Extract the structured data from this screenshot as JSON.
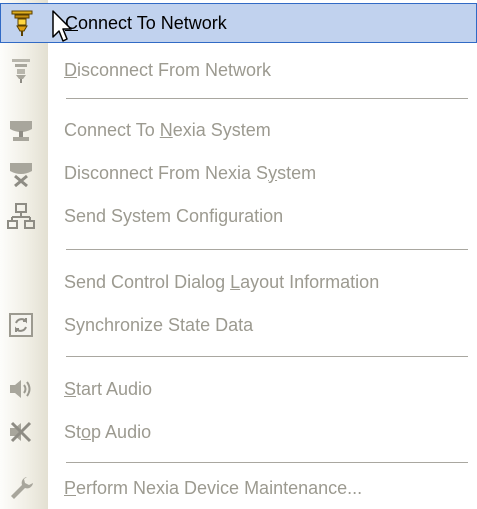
{
  "menu": {
    "items": [
      {
        "pre": "",
        "ul": "C",
        "post": "onnect To Network",
        "icon": "network-plug-icon",
        "state": "highlighted"
      },
      {
        "pre": "",
        "ul": "D",
        "post": "isconnect From Network",
        "icon": "network-unplug-icon",
        "state": "disabled"
      },
      {
        "pre": "Connect To ",
        "ul": "N",
        "post": "exia System",
        "icon": "system-connect-icon",
        "state": "disabled"
      },
      {
        "pre": "Disconnect From Nexia S",
        "ul": "y",
        "post": "stem",
        "icon": "system-disconnect-icon",
        "state": "disabled"
      },
      {
        "pre": "Send System Confi",
        "ul": "g",
        "post": "uration",
        "icon": "send-configuration-icon",
        "state": "disabled"
      },
      {
        "pre": "Send Control Dialog ",
        "ul": "L",
        "post": "ayout Information",
        "icon": "",
        "state": "disabled"
      },
      {
        "pre": "Synchronize State Data",
        "ul": "",
        "post": "",
        "icon": "synchronize-icon",
        "state": "disabled"
      },
      {
        "pre": "",
        "ul": "S",
        "post": "tart Audio",
        "icon": "speaker-icon",
        "state": "disabled"
      },
      {
        "pre": "St",
        "ul": "o",
        "post": "p Audio",
        "icon": "speaker-muted-icon",
        "state": "disabled"
      },
      {
        "pre": "",
        "ul": "P",
        "post": "erform Nexia Device Maintenance...",
        "icon": "wrench-icon",
        "state": "disabled"
      }
    ]
  },
  "colors": {
    "highlight_bg": "#c1d2ee",
    "highlight_border": "#316ac5",
    "disabled_text": "#9c9a90"
  },
  "cursor": {
    "icon": "arrow-cursor-icon"
  }
}
